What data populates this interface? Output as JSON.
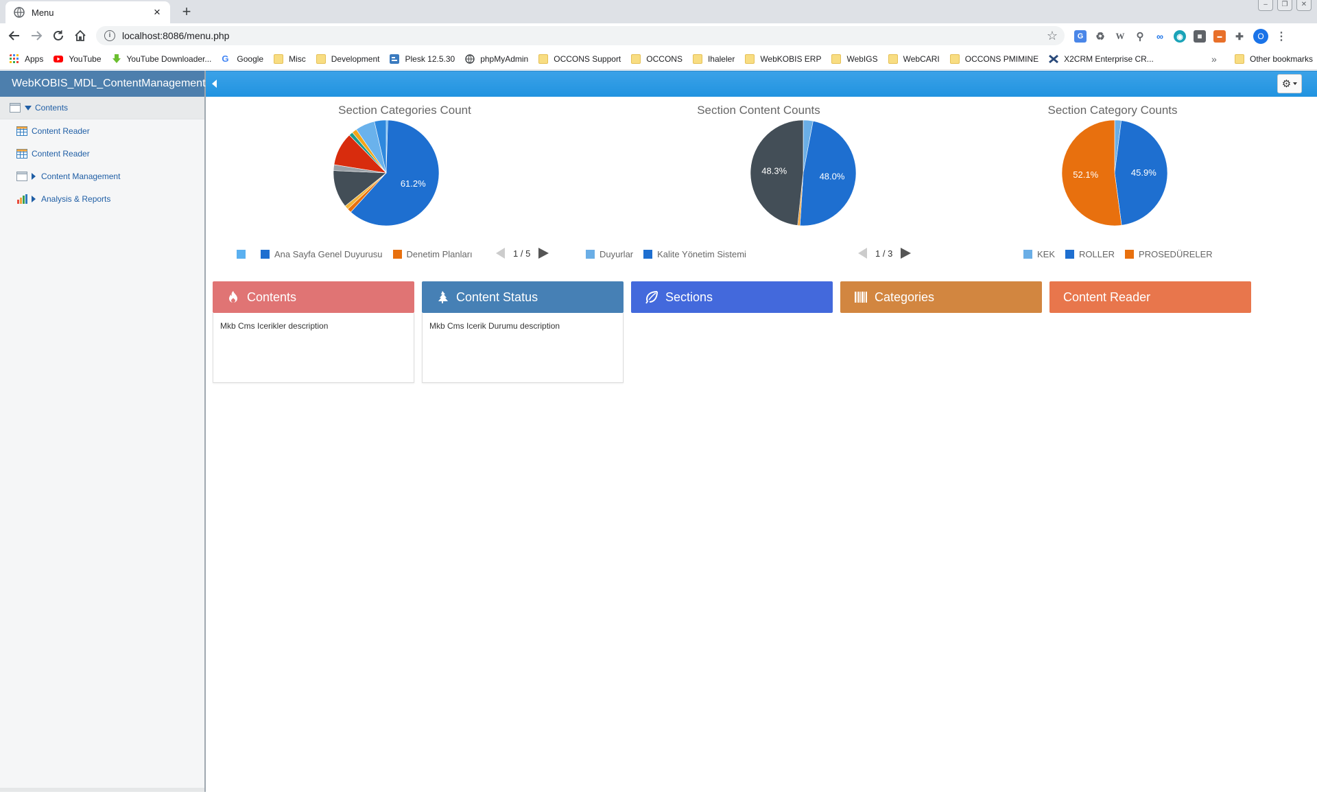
{
  "browser": {
    "tab_title": "Menu",
    "tab_close": "×",
    "new_tab": "+",
    "url": "localhost:8086/menu.php",
    "profile_initial": "O",
    "bookmarks": [
      {
        "label": "Apps",
        "icon": "apps-grid-icon"
      },
      {
        "label": "YouTube",
        "icon": "youtube-icon"
      },
      {
        "label": "YouTube Downloader...",
        "icon": "download-icon"
      },
      {
        "label": "Google",
        "icon": "google-icon"
      },
      {
        "label": "Misc",
        "icon": "folder-icon"
      },
      {
        "label": "Development",
        "icon": "folder-icon"
      },
      {
        "label": "Plesk 12.5.30",
        "icon": "plesk-icon"
      },
      {
        "label": "phpMyAdmin",
        "icon": "globe-icon"
      },
      {
        "label": "OCCONS Support",
        "icon": "folder-icon"
      },
      {
        "label": "OCCONS",
        "icon": "folder-icon"
      },
      {
        "label": "Ihaleler",
        "icon": "folder-icon"
      },
      {
        "label": "WebKOBIS ERP",
        "icon": "folder-icon"
      },
      {
        "label": "WebIGS",
        "icon": "folder-icon"
      },
      {
        "label": "WebCARI",
        "icon": "folder-icon"
      },
      {
        "label": "OCCONS PMIMINE",
        "icon": "folder-icon"
      },
      {
        "label": "X2CRM Enterprise CR...",
        "icon": "x2crm-icon"
      }
    ],
    "bookmarks_overflow": "»",
    "other_bookmarks": "Other bookmarks"
  },
  "sidebar": {
    "title": "WebKOBIS_MDL_ContentManagement",
    "items": [
      {
        "label": "Contents"
      },
      {
        "label": "Content Reader"
      },
      {
        "label": "Content Reader"
      },
      {
        "label": "Content Management"
      },
      {
        "label": "Analysis & Reports"
      }
    ]
  },
  "colors": {
    "topbar": "#2193e0",
    "sidebar_header": "#4d7fad",
    "card_contents": "#e07474",
    "card_content_status": "#4680b5",
    "card_sections": "#4369dc",
    "card_categories": "#d28640",
    "card_content_reader": "#e8764c"
  },
  "cards": [
    {
      "title": "Contents",
      "icon": "fire-icon",
      "description": "Mkb Cms Icerikler description"
    },
    {
      "title": "Content Status",
      "icon": "tree-icon",
      "description": "Mkb Cms Icerik Durumu description"
    },
    {
      "title": "Sections",
      "icon": "leaf-icon"
    },
    {
      "title": "Categories",
      "icon": "barcode-icon"
    },
    {
      "title": "Content Reader"
    }
  ],
  "chart_data": [
    {
      "type": "pie",
      "title": "Section Categories Count",
      "slices": [
        {
          "name": "",
          "value": 0.5,
          "color": "#5ab0f0"
        },
        {
          "name": "Ana Sayfa Genel Duyurusu",
          "value": 61.2,
          "color": "#1e6fd0",
          "label": "61.2%"
        },
        {
          "name": "Denetim Planları",
          "value": 1.3,
          "color": "#e8700e"
        },
        {
          "name": "",
          "value": 1.2,
          "color": "#f2b53a"
        },
        {
          "name": "",
          "value": 11.5,
          "color": "#434e57"
        },
        {
          "name": "",
          "value": 1.8,
          "color": "#9aa0a6"
        },
        {
          "name": "",
          "value": 10.2,
          "color": "#d82c0d"
        },
        {
          "name": "",
          "value": 1.2,
          "color": "#1a9b8c"
        },
        {
          "name": "",
          "value": 1.5,
          "color": "#f2a51a"
        },
        {
          "name": "",
          "value": 6.0,
          "color": "#6ab2ec"
        },
        {
          "name": "",
          "value": 3.6,
          "color": "#2e88de"
        }
      ],
      "legend": [
        "",
        "Ana Sayfa Genel Duyurusu",
        "Denetim Planları"
      ],
      "pager": "1 / 5"
    },
    {
      "type": "pie",
      "title": "Section Content Counts",
      "slices": [
        {
          "name": "Duyurlar",
          "value": 3.0,
          "color": "#6aaee6"
        },
        {
          "name": "Kalite Yönetim Sistemi",
          "value": 48.0,
          "color": "#1e6fd0",
          "label": "48.0%"
        },
        {
          "name": "",
          "value": 0.7,
          "color": "#f0a33a"
        },
        {
          "name": "",
          "value": 48.3,
          "color": "#434e57",
          "label": "48.3%"
        }
      ],
      "legend": [
        "Duyurlar",
        "Kalite Yönetim Sistemi"
      ],
      "pager": "1 / 3"
    },
    {
      "type": "pie",
      "title": "Section Category Counts",
      "slices": [
        {
          "name": "KEK",
          "value": 2.0,
          "color": "#6aaee6"
        },
        {
          "name": "ROLLER",
          "value": 45.9,
          "color": "#1e6fd0",
          "label": "45.9%"
        },
        {
          "name": "PROSEDÜRELER",
          "value": 52.1,
          "color": "#e8700e",
          "label": "52.1%"
        }
      ],
      "legend": [
        "KEK",
        "ROLLER",
        "PROSEDÜRELER"
      ]
    }
  ]
}
